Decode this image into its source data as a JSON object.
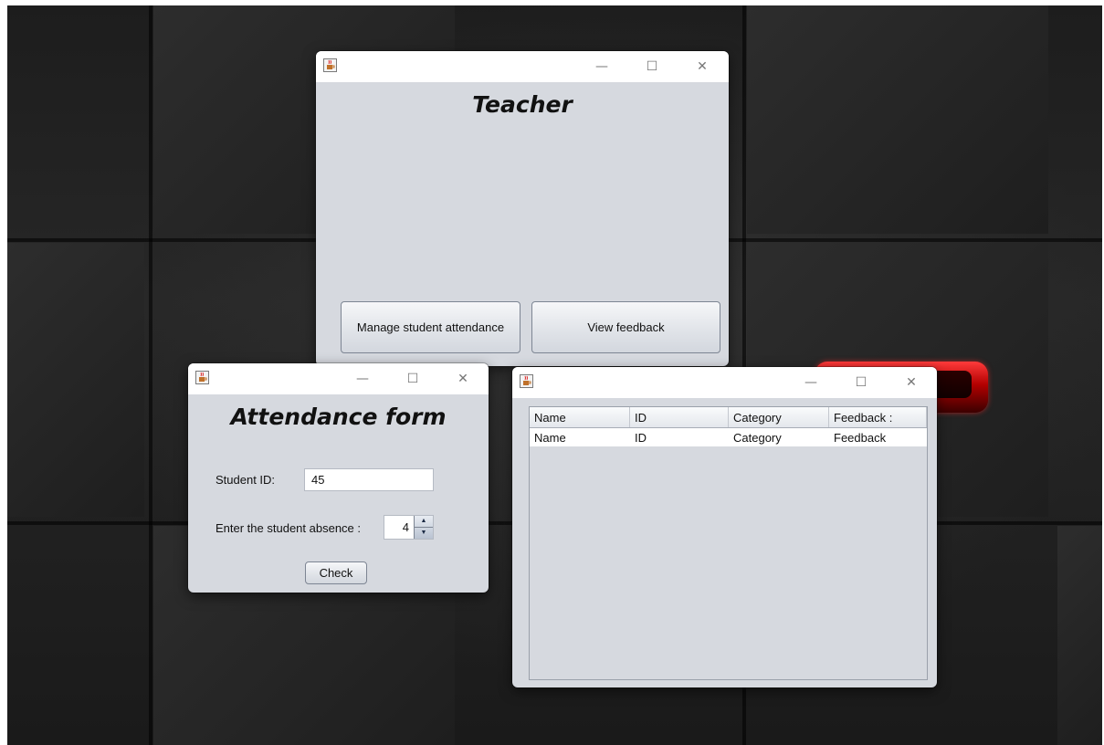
{
  "teacher_window": {
    "heading": "Teacher",
    "controls": {
      "minimize": "—",
      "maximize": "☐",
      "close": "✕"
    },
    "buttons": {
      "manage_attendance": "Manage student attendance",
      "view_feedback": "View feedback"
    }
  },
  "attendance_window": {
    "heading": "Attendance form",
    "controls": {
      "minimize": "—",
      "maximize": "☐",
      "close": "✕"
    },
    "student_id_label": "Student ID:",
    "student_id_value": "45",
    "absence_label": "Enter the student absence :",
    "absence_value": "4",
    "spinner_up": "▲",
    "spinner_down": "▼",
    "check_button": "Check"
  },
  "feedback_window": {
    "controls": {
      "minimize": "—",
      "maximize": "☐",
      "close": "✕"
    },
    "table": {
      "headers": [
        "Name",
        "ID",
        "Category",
        "Feedback :"
      ],
      "rows": [
        [
          "Name",
          "ID",
          "Category",
          "Feedback"
        ]
      ]
    }
  },
  "icons": {
    "app_icon": "java-cup-icon"
  }
}
